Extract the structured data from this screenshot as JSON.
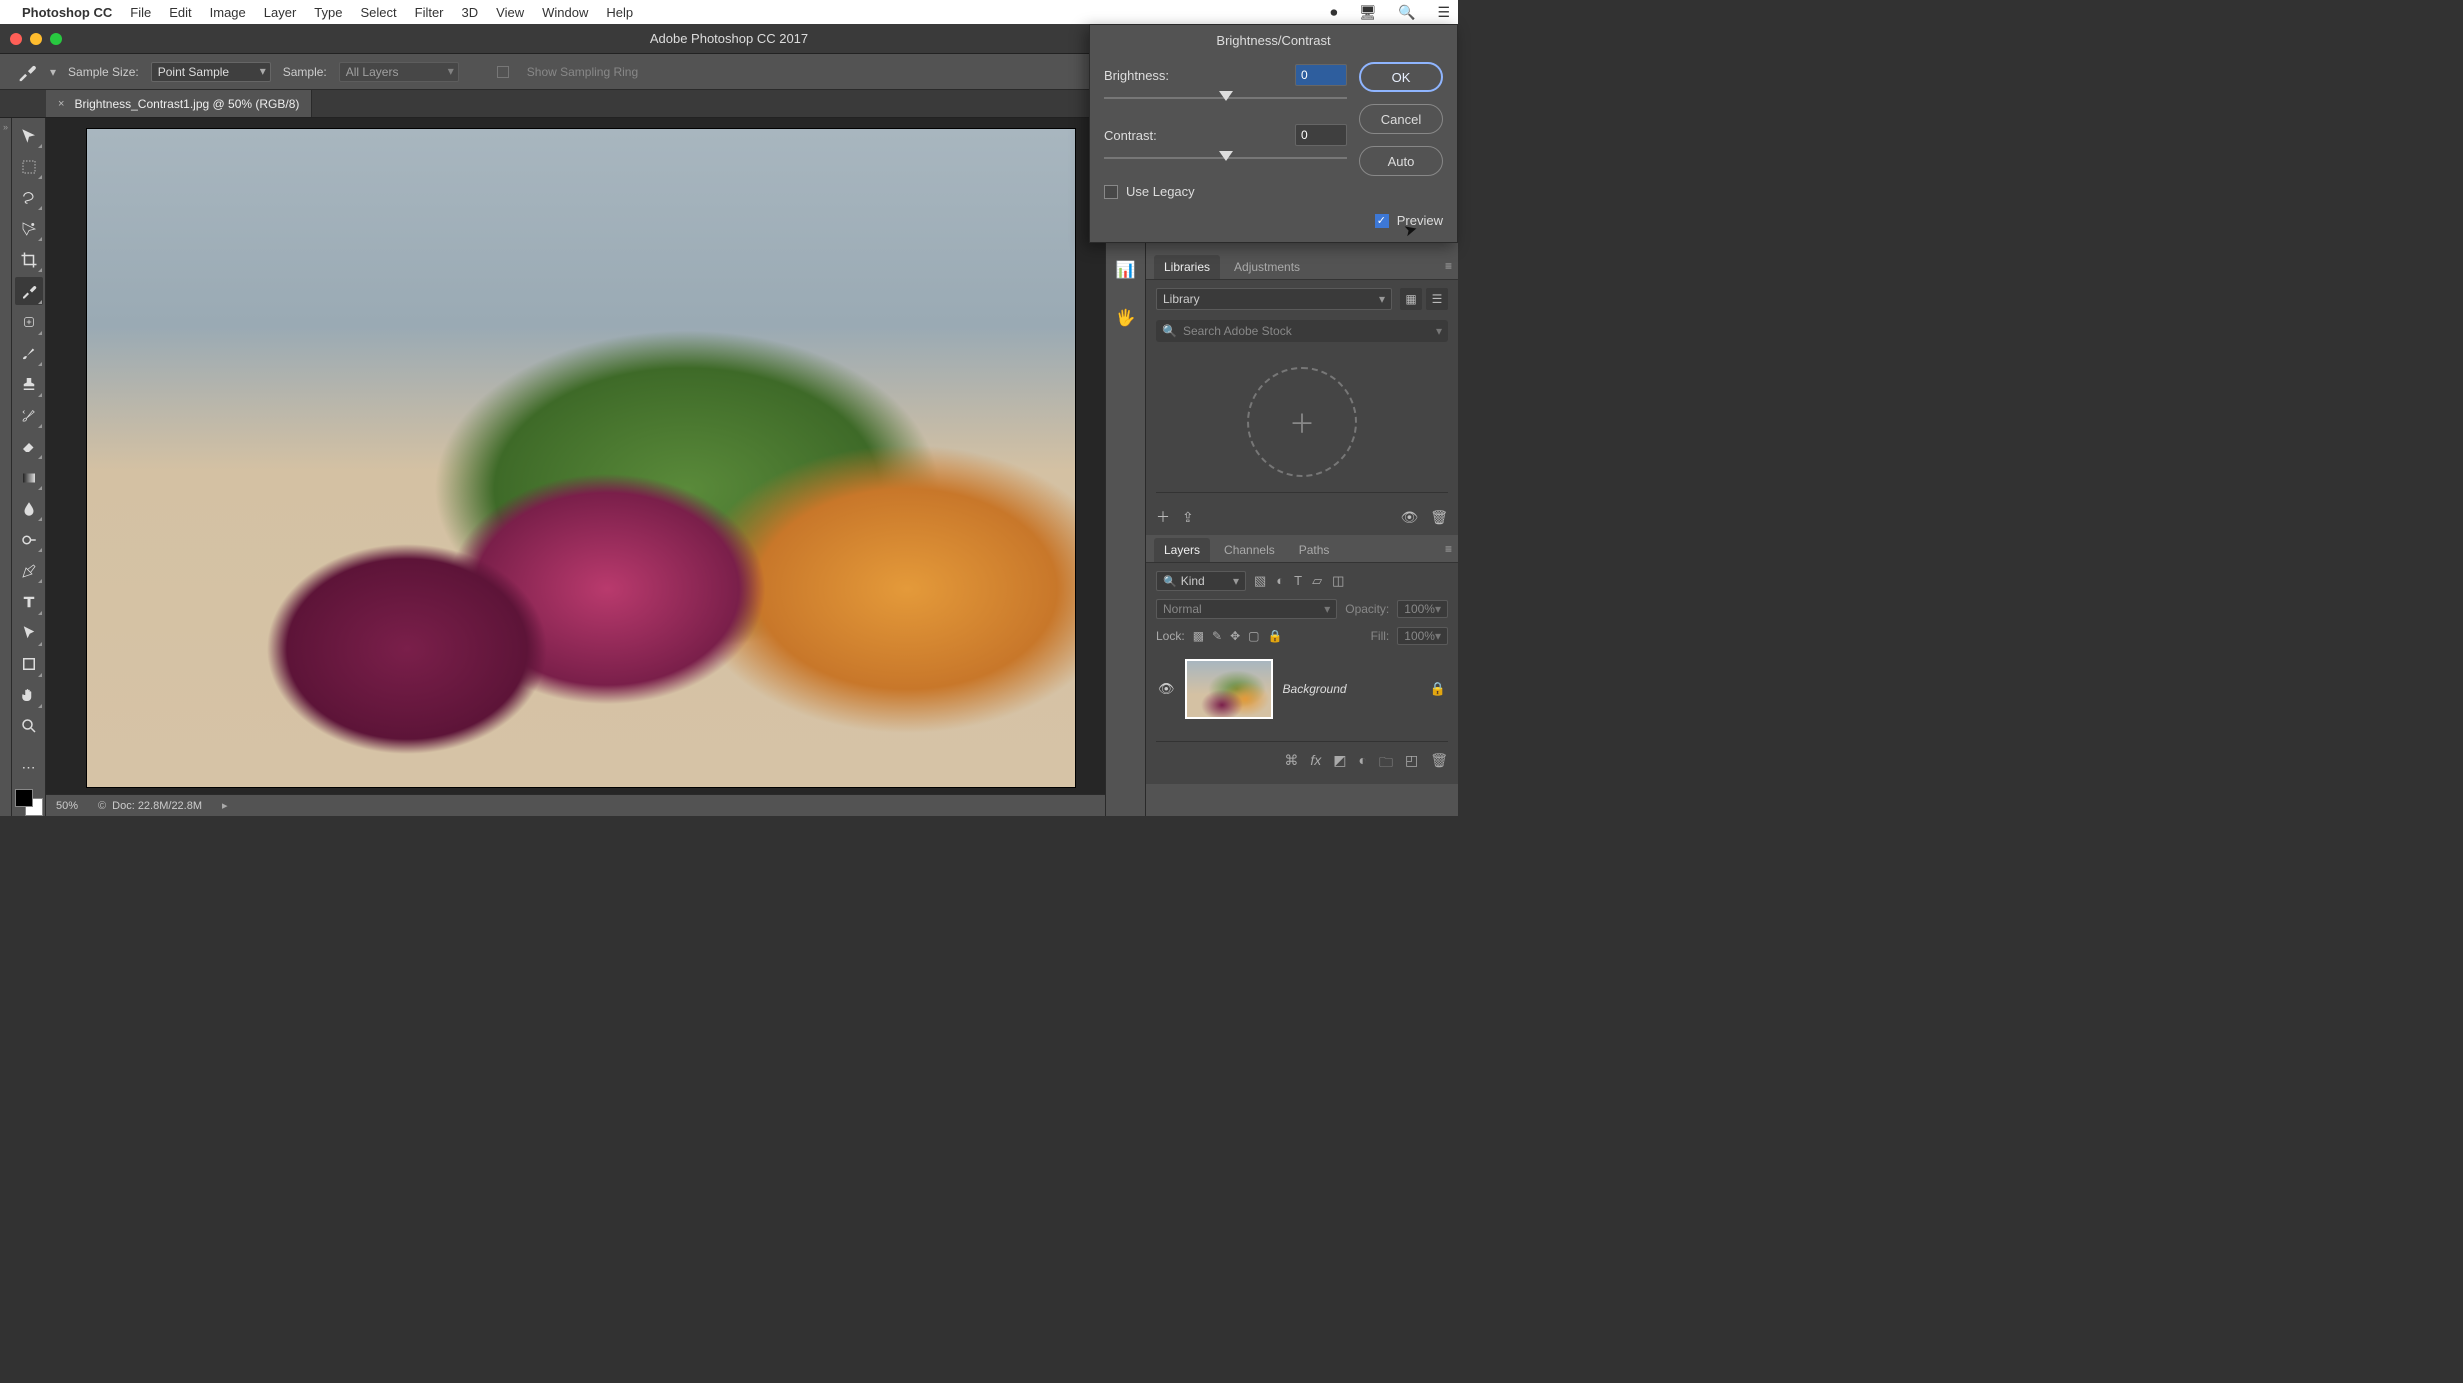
{
  "menubar": {
    "app": "Photoshop CC",
    "items": [
      "File",
      "Edit",
      "Image",
      "Layer",
      "Type",
      "Select",
      "Filter",
      "3D",
      "View",
      "Window",
      "Help"
    ]
  },
  "window": {
    "title": "Adobe Photoshop CC 2017"
  },
  "options": {
    "sample_size_label": "Sample Size:",
    "sample_size_value": "Point Sample",
    "sample_label": "Sample:",
    "sample_value": "All Layers",
    "show_ring": "Show Sampling Ring"
  },
  "doc_tab": {
    "name": "Brightness_Contrast1.jpg @ 50% (RGB/8)"
  },
  "status": {
    "zoom": "50%",
    "doc": "Doc: 22.8M/22.8M"
  },
  "dialog": {
    "title": "Brightness/Contrast",
    "brightness_label": "Brightness:",
    "brightness_value": "0",
    "contrast_label": "Contrast:",
    "contrast_value": "0",
    "use_legacy": "Use Legacy",
    "preview": "Preview",
    "ok": "OK",
    "cancel": "Cancel",
    "auto": "Auto"
  },
  "libraries": {
    "tabs": [
      "Libraries",
      "Adjustments"
    ],
    "library_select": "Library",
    "search_placeholder": "Search Adobe Stock"
  },
  "layers": {
    "tabs": [
      "Layers",
      "Channels",
      "Paths"
    ],
    "kind": "Kind",
    "blend": "Normal",
    "opacity_label": "Opacity:",
    "opacity_value": "100%",
    "lock_label": "Lock:",
    "fill_label": "Fill:",
    "fill_value": "100%",
    "layer_name": "Background"
  },
  "tools": [
    "move",
    "marquee",
    "lasso",
    "magic-wand",
    "crop",
    "eyedropper",
    "healing",
    "brush",
    "stamp",
    "history-brush",
    "eraser",
    "gradient",
    "blur",
    "dodge",
    "pen",
    "type",
    "path-select",
    "rectangle",
    "hand",
    "zoom"
  ]
}
